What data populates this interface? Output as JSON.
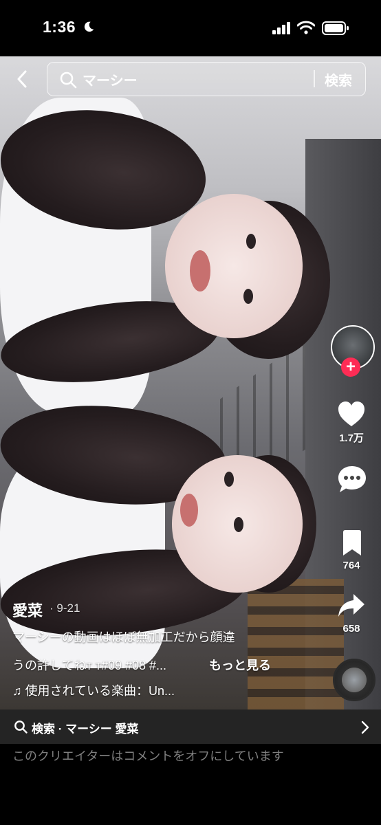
{
  "status_bar": {
    "time": "1:36"
  },
  "search": {
    "query": "マーシー",
    "button_label": "検索"
  },
  "side_actions": {
    "likes": "1.7万",
    "bookmarks": "764",
    "shares": "658",
    "follow_label": "+"
  },
  "post": {
    "username": "愛菜",
    "date": "· 9-21",
    "caption_line1": "マーシーの動画はほぼ無加工だから顔違",
    "caption_line2": "うの許してねт т#09 #08 #...",
    "more_label": "もっと見る",
    "music": "♫ 使用されている楽曲：Un..."
  },
  "related_search": {
    "label": "検索 · マーシー 愛菜"
  },
  "comments": {
    "notice": "このクリエイターはコメントをオフにしています"
  },
  "colors": {
    "accent": "#fe2c55",
    "background": "#000000",
    "notice_text": "#7f7f7f"
  }
}
